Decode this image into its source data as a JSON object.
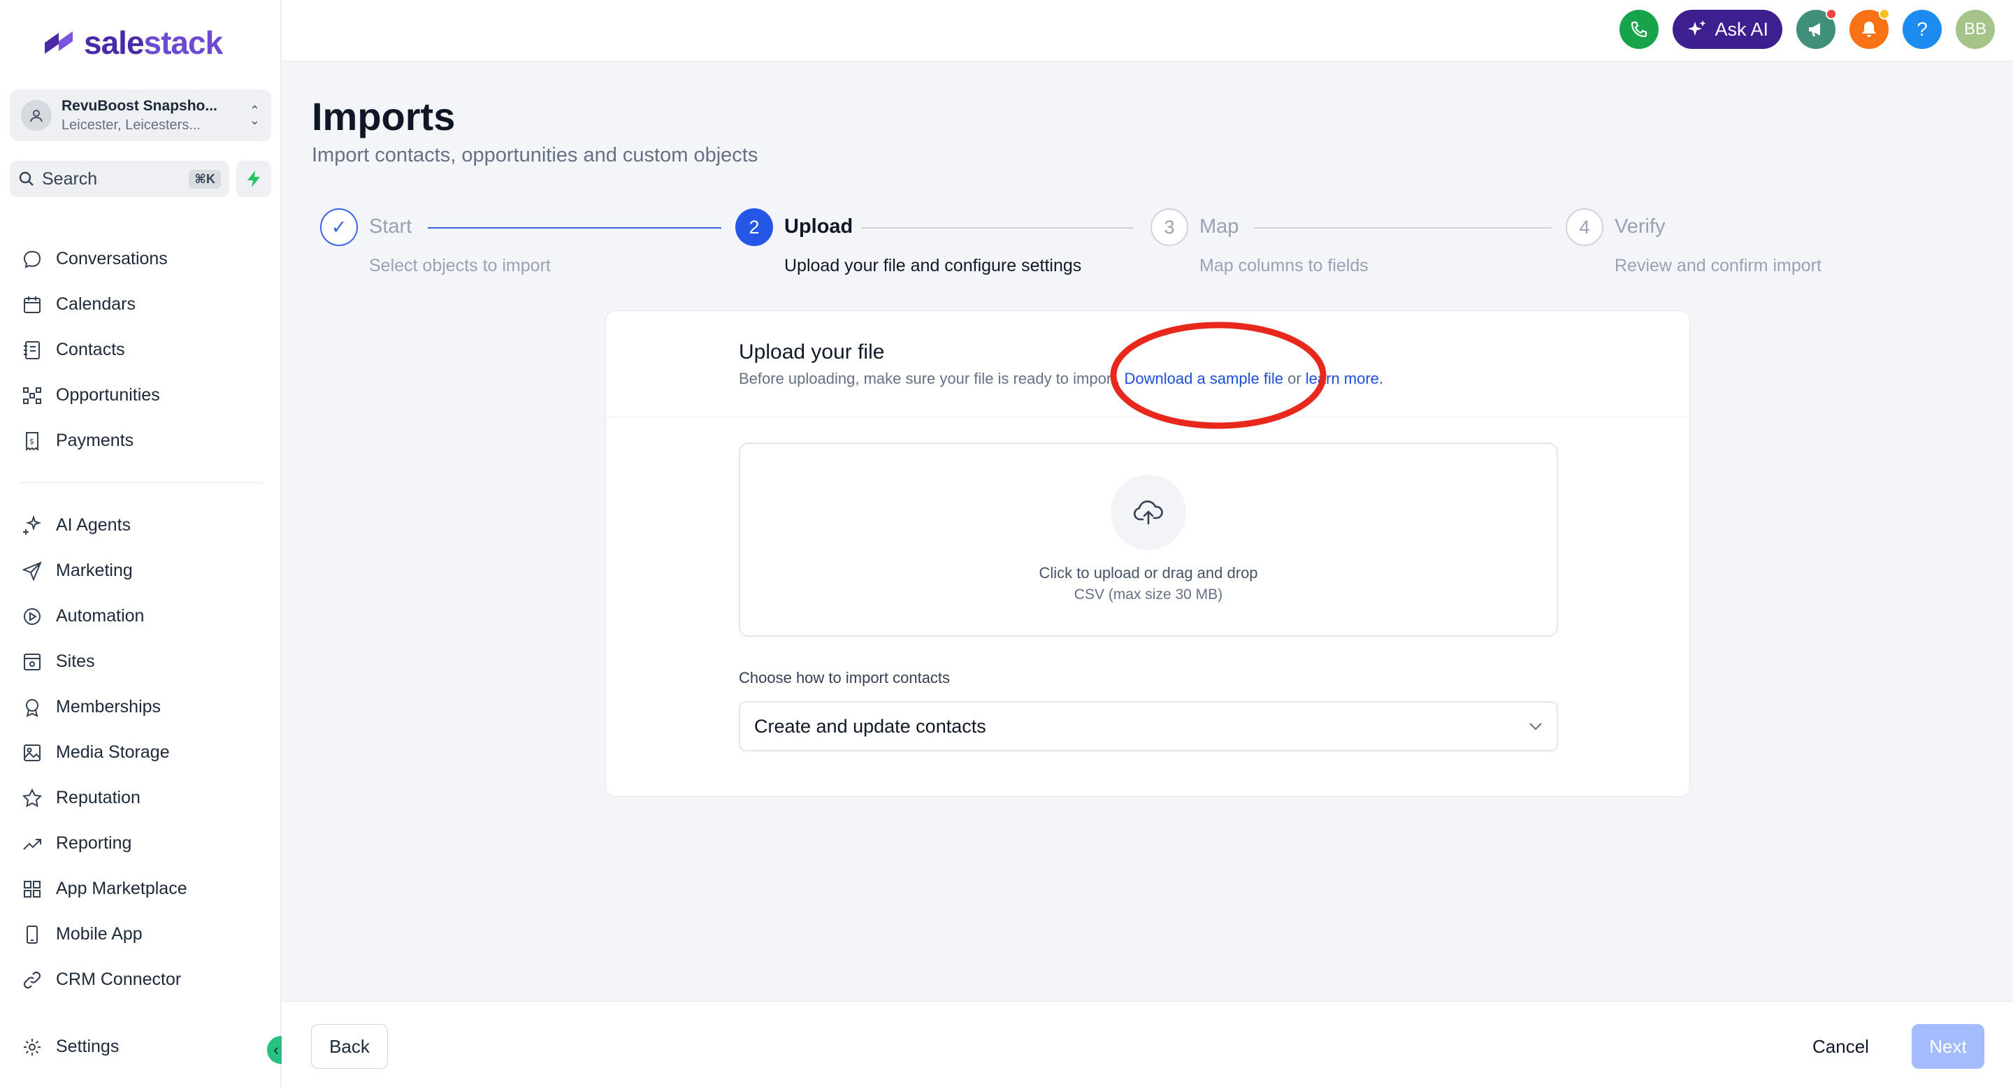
{
  "brand": {
    "logo_text_bold": "sale",
    "logo_text_light": "stack"
  },
  "account": {
    "name": "RevuBoost Snapsho...",
    "location": "Leicester, Leicesters..."
  },
  "search": {
    "label": "Search",
    "shortcut": "⌘K"
  },
  "nav_primary": [
    {
      "label": "Conversations",
      "icon": "chat-bubble-icon"
    },
    {
      "label": "Calendars",
      "icon": "calendar-icon"
    },
    {
      "label": "Contacts",
      "icon": "contacts-book-icon"
    },
    {
      "label": "Opportunities",
      "icon": "pipeline-icon"
    },
    {
      "label": "Payments",
      "icon": "receipt-icon"
    }
  ],
  "nav_secondary": [
    {
      "label": "AI Agents",
      "icon": "sparkle-icon"
    },
    {
      "label": "Marketing",
      "icon": "send-icon"
    },
    {
      "label": "Automation",
      "icon": "play-circle-icon"
    },
    {
      "label": "Sites",
      "icon": "site-icon"
    },
    {
      "label": "Memberships",
      "icon": "badge-icon"
    },
    {
      "label": "Media Storage",
      "icon": "image-icon"
    },
    {
      "label": "Reputation",
      "icon": "star-icon"
    },
    {
      "label": "Reporting",
      "icon": "trend-icon"
    },
    {
      "label": "App Marketplace",
      "icon": "grid-icon"
    },
    {
      "label": "Mobile App",
      "icon": "phone-device-icon"
    },
    {
      "label": "CRM Connector",
      "icon": "link-icon"
    }
  ],
  "settings": {
    "label": "Settings"
  },
  "topbar": {
    "ask_ai": "Ask AI",
    "help": "?",
    "avatar": "BB"
  },
  "page": {
    "title": "Imports",
    "subtitle": "Import contacts, opportunities and custom objects"
  },
  "steps": [
    {
      "number": "✓",
      "title": "Start",
      "desc": "Select objects to import",
      "state": "done"
    },
    {
      "number": "2",
      "title": "Upload",
      "desc": "Upload your file and configure settings",
      "state": "active"
    },
    {
      "number": "3",
      "title": "Map",
      "desc": "Map columns to fields",
      "state": "pending"
    },
    {
      "number": "4",
      "title": "Verify",
      "desc": "Review and confirm import",
      "state": "pending"
    }
  ],
  "card": {
    "title": "Upload your file",
    "desc_prefix": "Before uploading, make sure your file is ready to import. ",
    "sample_link": "Download a sample file",
    "desc_or": " or ",
    "learn_link": "learn more.",
    "dropzone_text": "Click to upload or drag and drop",
    "dropzone_sub": "CSV (max size 30 MB)",
    "select_label": "Choose how to import contacts",
    "select_value": "Create and update contacts"
  },
  "footer": {
    "back": "Back",
    "cancel": "Cancel",
    "next": "Next"
  },
  "colors": {
    "accent": "#2563eb",
    "brand": "#4b2aa8",
    "annotation": "#e8281c",
    "next_disabled": "#a4bcfd"
  }
}
